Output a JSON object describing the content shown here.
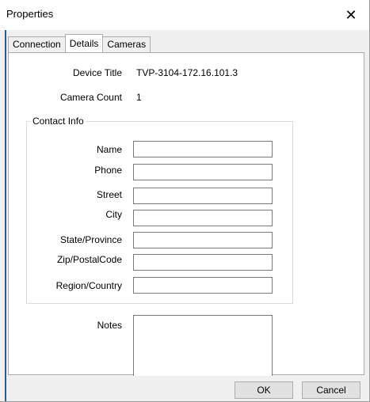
{
  "window": {
    "title": "Properties",
    "close_glyph": "✕"
  },
  "tabs": [
    {
      "label": "Connection",
      "active": false
    },
    {
      "label": "Details",
      "active": true
    },
    {
      "label": "Cameras",
      "active": false
    }
  ],
  "details": {
    "device_title_label": "Device Title",
    "device_title_value": "TVP-3104-172.16.101.3",
    "camera_count_label": "Camera Count",
    "camera_count_value": "1"
  },
  "contact_info": {
    "group_title": "Contact Info",
    "fields": [
      {
        "label": "Name",
        "value": ""
      },
      {
        "label": "Phone",
        "value": ""
      },
      {
        "label": "Street",
        "value": ""
      },
      {
        "label": "City",
        "value": ""
      },
      {
        "label": "State/Province",
        "value": ""
      },
      {
        "label": "Zip/PostalCode",
        "value": ""
      },
      {
        "label": "Region/Country",
        "value": ""
      }
    ]
  },
  "notes": {
    "label": "Notes",
    "value": ""
  },
  "buttons": {
    "ok_label": "OK",
    "cancel_label": "Cancel"
  }
}
